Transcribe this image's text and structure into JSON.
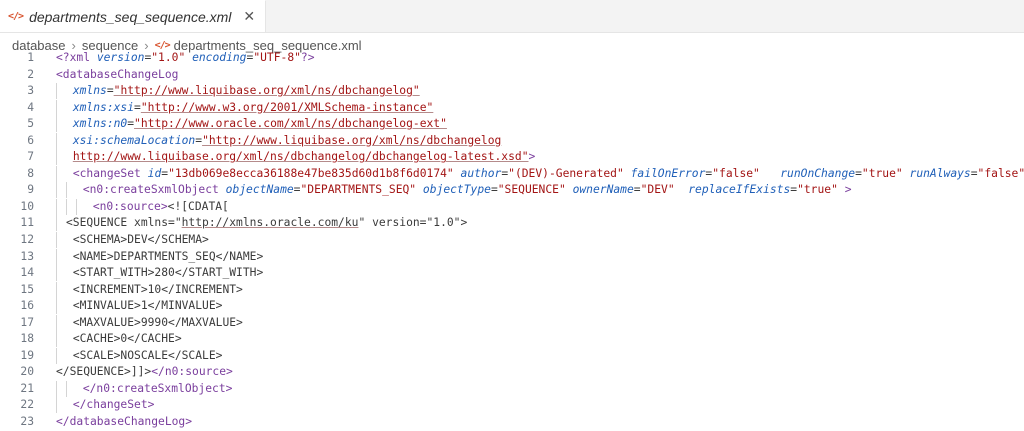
{
  "tab": {
    "title": "departments_seq_sequence.xml",
    "icon": "</>",
    "close": "✕"
  },
  "breadcrumb": {
    "items": [
      "database",
      "sequence",
      "departments_seq_sequence.xml"
    ]
  },
  "line_numbers": [
    "1",
    "2",
    "3",
    "4",
    "5",
    "6",
    "7",
    "8",
    "9",
    "10",
    "11",
    "12",
    "13",
    "14",
    "15",
    "16",
    "17",
    "18",
    "19",
    "20",
    "21",
    "22",
    "23"
  ],
  "code": {
    "l1": {
      "decl": "<?xml",
      "a1": "version",
      "v1": "\"1.0\"",
      "a2": "encoding",
      "v2": "\"UTF-8\"",
      "end": "?>"
    },
    "l2": {
      "tag": "<databaseChangeLog"
    },
    "l3": {
      "attr": "xmlns",
      "val": "\"http://www.liquibase.org/xml/ns/dbchangelog\""
    },
    "l4": {
      "attr": "xmlns:xsi",
      "val": "\"http://www.w3.org/2001/XMLSchema-instance\""
    },
    "l5": {
      "attr": "xmlns:n0",
      "val": "\"http://www.oracle.com/xml/ns/dbchangelog-ext\""
    },
    "l6": {
      "attr": "xsi:schemaLocation",
      "val": "\"http://www.liquibase.org/xml/ns/dbchangelog"
    },
    "l7": {
      "val": "http://www.liquibase.org/xml/ns/dbchangelog/dbchangelog-latest.xsd\"",
      "end": ">"
    },
    "l8": {
      "tag": "<changeSet",
      "a1": "id",
      "v1": "\"13db069e8ecca36188e47be835d60d1b8f6d0174\"",
      "a2": "author",
      "v2": "\"(DEV)-Generated\"",
      "a3": "failOnError",
      "v3": "\"false\"",
      "a4": "runOnChange",
      "v4": "\"true\"",
      "a5": "runAlways",
      "v5": "\"false\"",
      "end": ">"
    },
    "l9": {
      "tag": "<n0:createSxmlObject",
      "a1": "objectName",
      "v1": "\"DEPARTMENTS_SEQ\"",
      "a2": "objectType",
      "v2": "\"SEQUENCE\"",
      "a3": "ownerName",
      "v3": "\"DEV\"",
      "a4": "replaceIfExists",
      "v4": "\"true\"",
      "end": ">"
    },
    "l10": {
      "tag": "<n0:source>",
      "text": "<![CDATA["
    },
    "l11": {
      "text1": "<SEQUENCE xmlns=\"",
      "url": "http://xmlns.oracle.com/ku",
      "text2": "\" version=\"1.0\">"
    },
    "l12": "<SCHEMA>DEV</SCHEMA>",
    "l13": "<NAME>DEPARTMENTS_SEQ</NAME>",
    "l14": "<START_WITH>280</START_WITH>",
    "l15": "<INCREMENT>10</INCREMENT>",
    "l16": "<MINVALUE>1</MINVALUE>",
    "l17": "<MAXVALUE>9990</MAXVALUE>",
    "l18": "<CACHE>0</CACHE>",
    "l19": "<SCALE>NOSCALE</SCALE>",
    "l20": {
      "text": "</SEQUENCE>]]>",
      "tag": "</n0:source>"
    },
    "l21": {
      "tag": "</n0:createSxmlObject>"
    },
    "l22": {
      "tag": "</changeSet>"
    },
    "l23": {
      "tag": "</databaseChangeLog>"
    }
  },
  "colors": {
    "tag": "#800000",
    "attribute": "#1f5fb8",
    "string": "#a31515",
    "xml_icon": "#d8542f"
  }
}
